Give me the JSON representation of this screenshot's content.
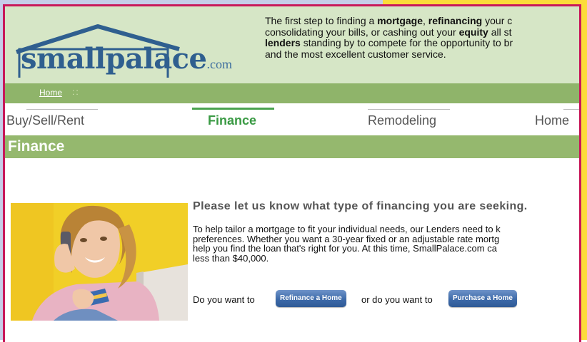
{
  "brand": {
    "name": "smallpalace",
    "tld": ".com"
  },
  "intro_lines": [
    [
      {
        "t": "The first step to finding a "
      },
      {
        "t": "mortgage",
        "b": true
      },
      {
        "t": ", "
      },
      {
        "t": "refinancing",
        "b": true
      },
      {
        "t": " your c"
      }
    ],
    [
      {
        "t": "consolidating your bills, or cashing out your "
      },
      {
        "t": "equity",
        "b": true
      },
      {
        "t": " all st"
      }
    ],
    [
      {
        "t": "lenders",
        "b": true
      },
      {
        "t": " standing by to compete for the opportunity to br"
      }
    ],
    [
      {
        "t": "and the most excellent customer service."
      }
    ]
  ],
  "breadcrumb": {
    "home": "Home",
    "separator": "::"
  },
  "tabs": [
    {
      "label": "Buy/Sell/Rent",
      "active": false
    },
    {
      "label": "Finance",
      "active": true
    },
    {
      "label": "Remodeling",
      "active": false
    },
    {
      "label": "Home",
      "active": false
    }
  ],
  "section": {
    "title": "Finance"
  },
  "content": {
    "title": "Please let us know what type of financing you are seeking.",
    "body_lines": [
      "To help tailor a mortgage to fit your individual needs, our Lenders need to k",
      "preferences. Whether you want a 30-year fixed or an adjustable rate mortg",
      "help you find the loan that's right for you.  At this time, SmallPalace.com ca",
      "less than $40,000."
    ],
    "cta": {
      "prefix": "Do you want to",
      "refinance_label": "Refinance a Home",
      "middle": "or do you want to",
      "purchase_label": "Purchase a Home"
    }
  },
  "colors": {
    "accent_green": "#95b86e",
    "tab_active": "#3a9a44",
    "frame": "#c8185a",
    "button_blue": "#3d6aa9"
  },
  "icons": {
    "logo": "house-roof-logo",
    "photo": "woman-on-phone-with-card-photo"
  }
}
